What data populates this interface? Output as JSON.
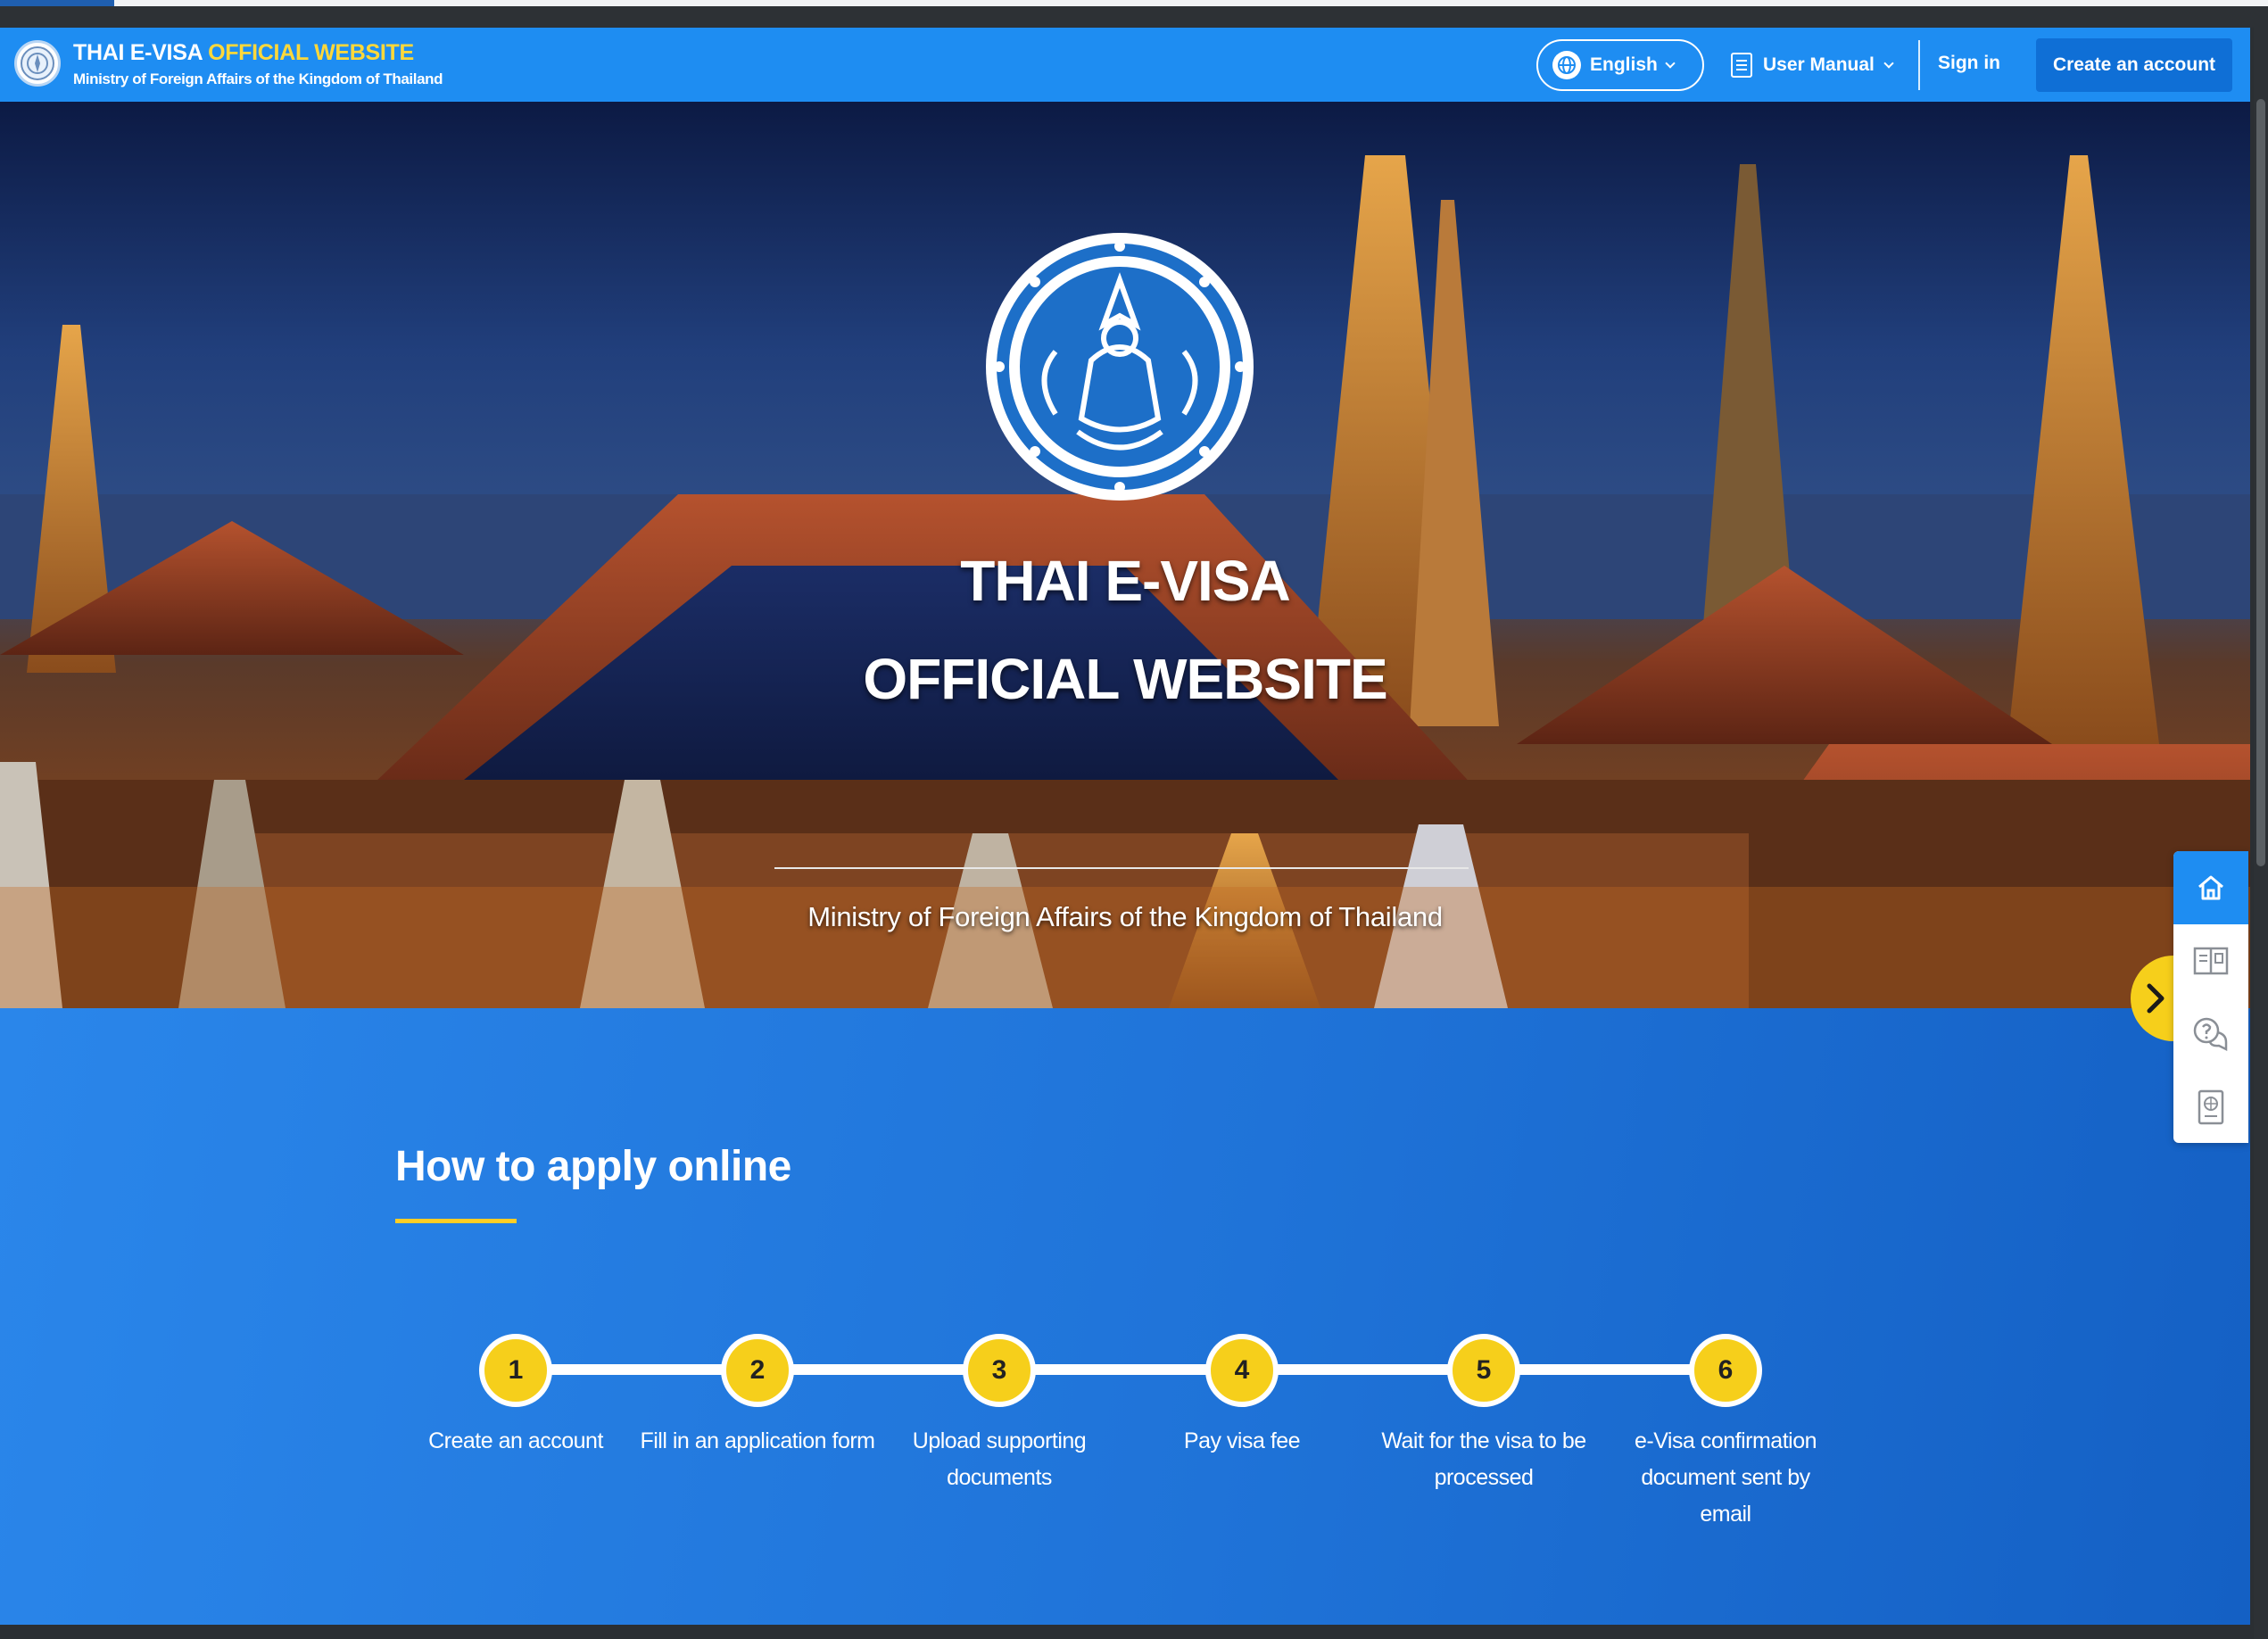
{
  "header": {
    "brand_title_main": "THAI E-VISA",
    "brand_title_accent": "OFFICIAL WEBSITE",
    "brand_subtitle": "Ministry of Foreign Affairs of the Kingdom of Thailand",
    "language_label": "English",
    "user_manual_label": "User Manual",
    "sign_in_label": "Sign in",
    "create_account_label": "Create an account"
  },
  "hero": {
    "title_line1": "THAI E-VISA",
    "title_line2": "OFFICIAL WEBSITE",
    "subtitle": "Ministry of Foreign Affairs of the Kingdom of Thailand"
  },
  "how_to_apply": {
    "title": "How to apply online",
    "steps": [
      {
        "number": "1",
        "label": "Create an account"
      },
      {
        "number": "2",
        "label": "Fill in an application form"
      },
      {
        "number": "3",
        "label": "Upload supporting documents"
      },
      {
        "number": "4",
        "label": "Pay visa fee"
      },
      {
        "number": "5",
        "label": "Wait for the visa to be processed"
      },
      {
        "number": "6",
        "label": "e-Visa confirmation document sent by email"
      }
    ]
  },
  "side_tools": {
    "icons": [
      "home-icon",
      "visa-document-icon",
      "faq-icon",
      "passport-icon"
    ],
    "toggle_icon": "chevron-right-icon"
  },
  "colors": {
    "brand_blue": "#1e8df2",
    "accent_yellow": "#ffd83a",
    "step_yellow": "#f6cf1b"
  }
}
